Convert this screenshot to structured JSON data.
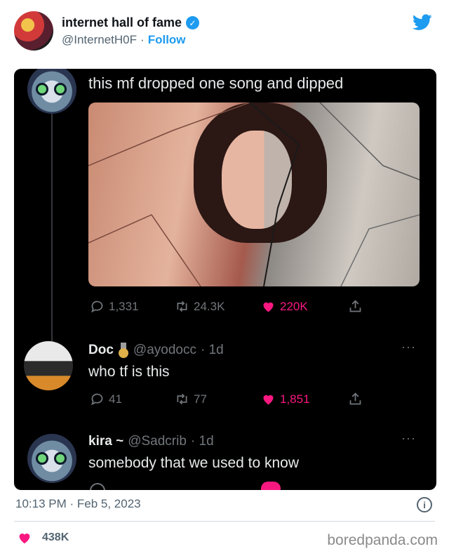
{
  "header": {
    "name": "internet hall of fame",
    "handle": "@InternetH0F",
    "separator": "·",
    "follow_label": "Follow"
  },
  "screenshot": {
    "main_tweet": {
      "text": "this mf dropped one song and dipped",
      "image_description_icon": "meme-image",
      "replies": "1,331",
      "retweets": "24.3K",
      "likes": "220K"
    },
    "replies": [
      {
        "name": "Doc",
        "handle": "@ayodocc",
        "time": "· 1d",
        "text": "who tf is this",
        "replies": "41",
        "retweets": "77",
        "likes": "1,851"
      },
      {
        "name": "kira ~",
        "handle": "@Sadcrib",
        "time": "· 1d",
        "text": "somebody that we used to know"
      }
    ]
  },
  "footer": {
    "timestamp": "10:13 PM · Feb 5, 2023",
    "like_count": "438K",
    "watermark": "boredpanda.com"
  },
  "colors": {
    "accent": "#1d9bf0",
    "like": "#f91880",
    "panel_bg": "#000000"
  }
}
